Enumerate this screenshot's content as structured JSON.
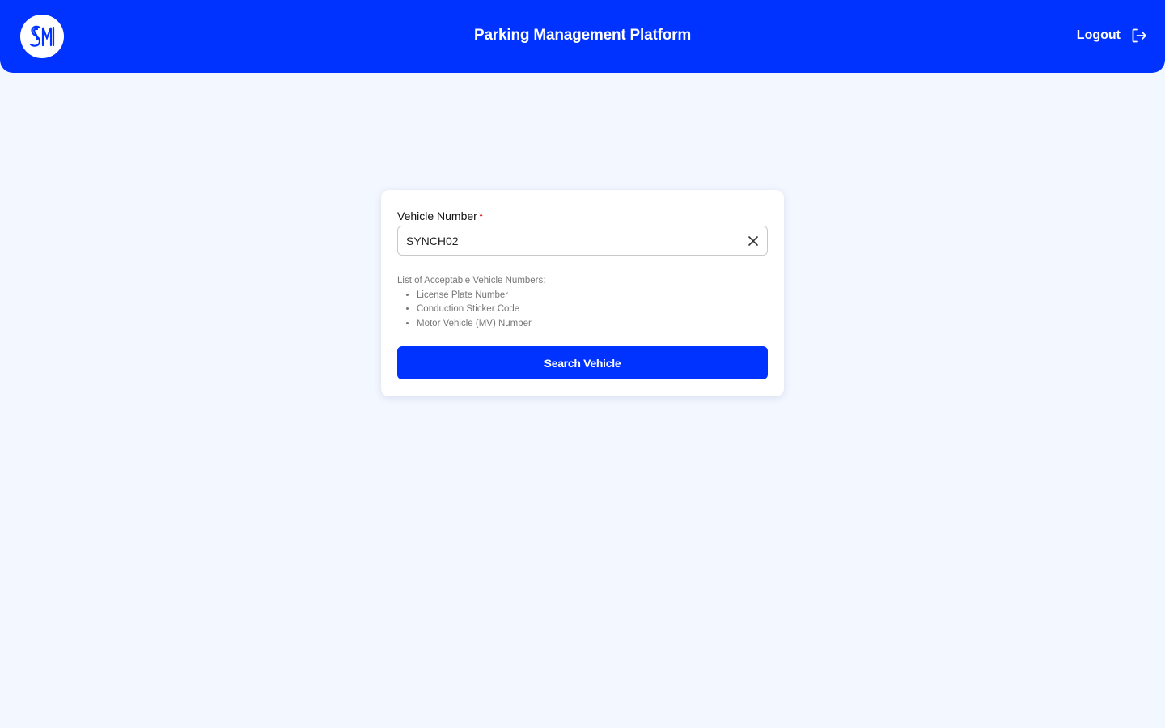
{
  "header": {
    "logo_text": "SM",
    "title": "Parking Management Platform",
    "logout_label": "Logout",
    "logout_icon": "logout-icon"
  },
  "form": {
    "vehicle_label": "Vehicle Number",
    "required_marker": "*",
    "vehicle_value": "SYNCH02",
    "clear_icon": "close-icon",
    "hint_title": "List of Acceptable Vehicle Numbers:",
    "hint_items": [
      "License Plate Number",
      "Conduction Sticker Code",
      "Motor Vehicle (MV) Number"
    ],
    "search_label": "Search Vehicle"
  },
  "colors": {
    "brand": "#0033ff",
    "background": "#f3f7ff",
    "required": "#e00000"
  }
}
